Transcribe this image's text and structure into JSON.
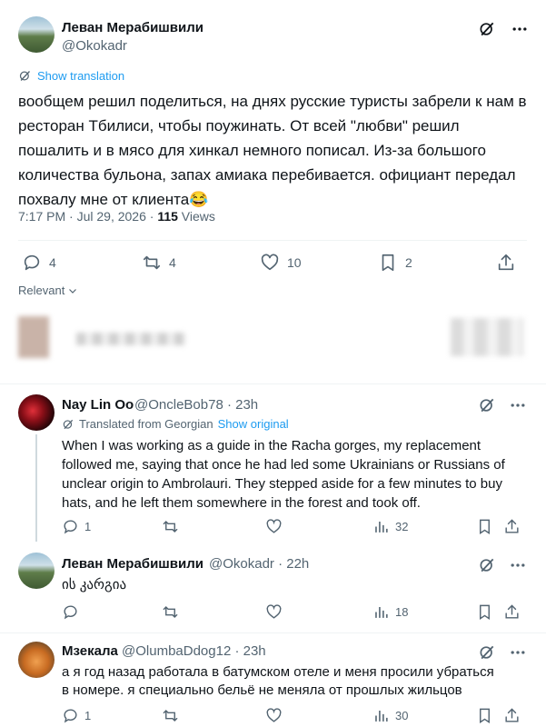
{
  "main_tweet": {
    "author_name": "Леван Мерабишвили",
    "author_handle": "@Okokadr",
    "translate_label": "Show translation",
    "text": "вообщем решил поделиться, на днях русские туристы забрели к нам в ресторан Тбилиси, чтобы поужинать. От всей \"любви\" решил пошалить и в мясо для хинкал немного пописал. Из-за большого количества бульона, запах амиака перебивается. официант передал похвалу мне от клиента😂",
    "time": "7:17 PM · Jul 29, 2026 ·",
    "views_count": "115",
    "views_label": "Views",
    "stats": {
      "replies": "4",
      "reposts": "4",
      "likes": "10",
      "bookmarks": "2"
    }
  },
  "sort_label": "Relevant",
  "replies": [
    {
      "author_name": "Nay Lin Oo",
      "author_handle": "@OncleBob78 · 23h",
      "translated_note": "Translated from Georgian",
      "show_original": "Show original",
      "text": "When I was working as a guide in the Racha gorges, my replacement followed me, saying that once he had led some Ukrainians or Russians of unclear origin to Ambrolauri. They stepped aside for a few minutes to buy hats, and he left them somewhere in the forest and took off.",
      "stats": {
        "replies": "1",
        "reposts": "",
        "likes": "",
        "views": "32"
      }
    },
    {
      "author_name": "Леван Мерабишвили",
      "author_handle": "@Okokadr · 22h",
      "text": "ის კარგია",
      "stats": {
        "replies": "",
        "reposts": "",
        "likes": "",
        "views": "18"
      }
    },
    {
      "author_name": "Мзекала",
      "author_handle": "@OlumbaDdog12 · 23h",
      "text": "а я год назад работала в батумском отеле и меня просили убраться в номере. я специально бельё не меняла от прошлых жильцов",
      "stats": {
        "replies": "1",
        "reposts": "",
        "likes": "",
        "views": "30"
      }
    }
  ],
  "icons": [
    "grok-icon",
    "more-icon",
    "reply-icon",
    "repost-icon",
    "like-icon",
    "bookmark-icon",
    "share-icon",
    "views-icon",
    "translate-icon",
    "chevron-down-icon"
  ],
  "colors": {
    "accent": "#1d9bf0",
    "secondary_text": "#536471",
    "primary_text": "#0f1419"
  }
}
